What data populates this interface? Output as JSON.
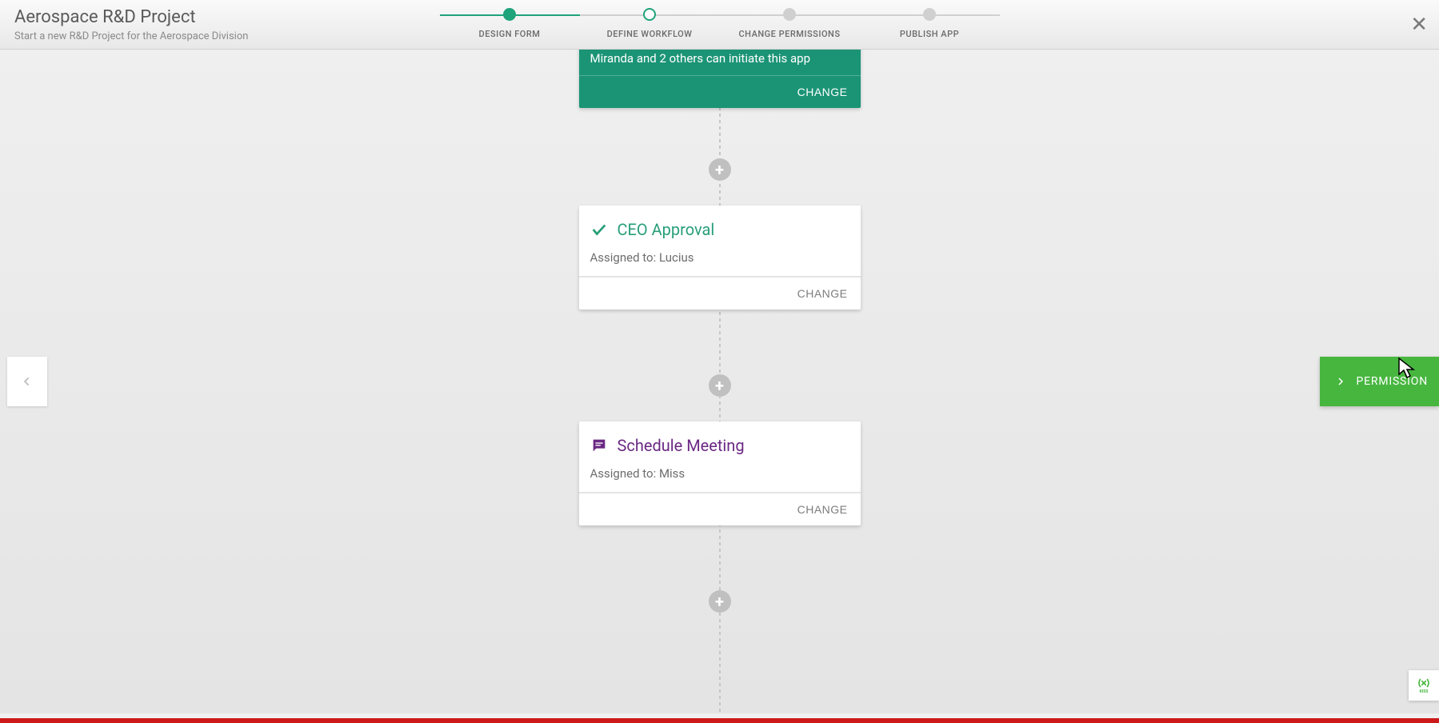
{
  "header": {
    "title": "Aerospace R&D Project",
    "subtitle": "Start a new R&D Project for the Aerospace Division"
  },
  "steps": [
    {
      "label": "DESIGN FORM"
    },
    {
      "label": "DEFINE WORKFLOW"
    },
    {
      "label": "CHANGE PERMISSIONS"
    },
    {
      "label": "PUBLISH APP"
    }
  ],
  "initiator_card": {
    "text": "Miranda and 2 others can initiate this app",
    "action": "CHANGE"
  },
  "approval_card": {
    "title": "CEO Approval",
    "assigned_prefix": "Assigned to: ",
    "assigned_value": "Lucius",
    "action": "CHANGE"
  },
  "meeting_card": {
    "title": "Schedule Meeting",
    "assigned_prefix": "Assigned to: ",
    "assigned_value": "Miss",
    "action": "CHANGE"
  },
  "perm_button": "PERMISSION",
  "brand_label": "KISS"
}
